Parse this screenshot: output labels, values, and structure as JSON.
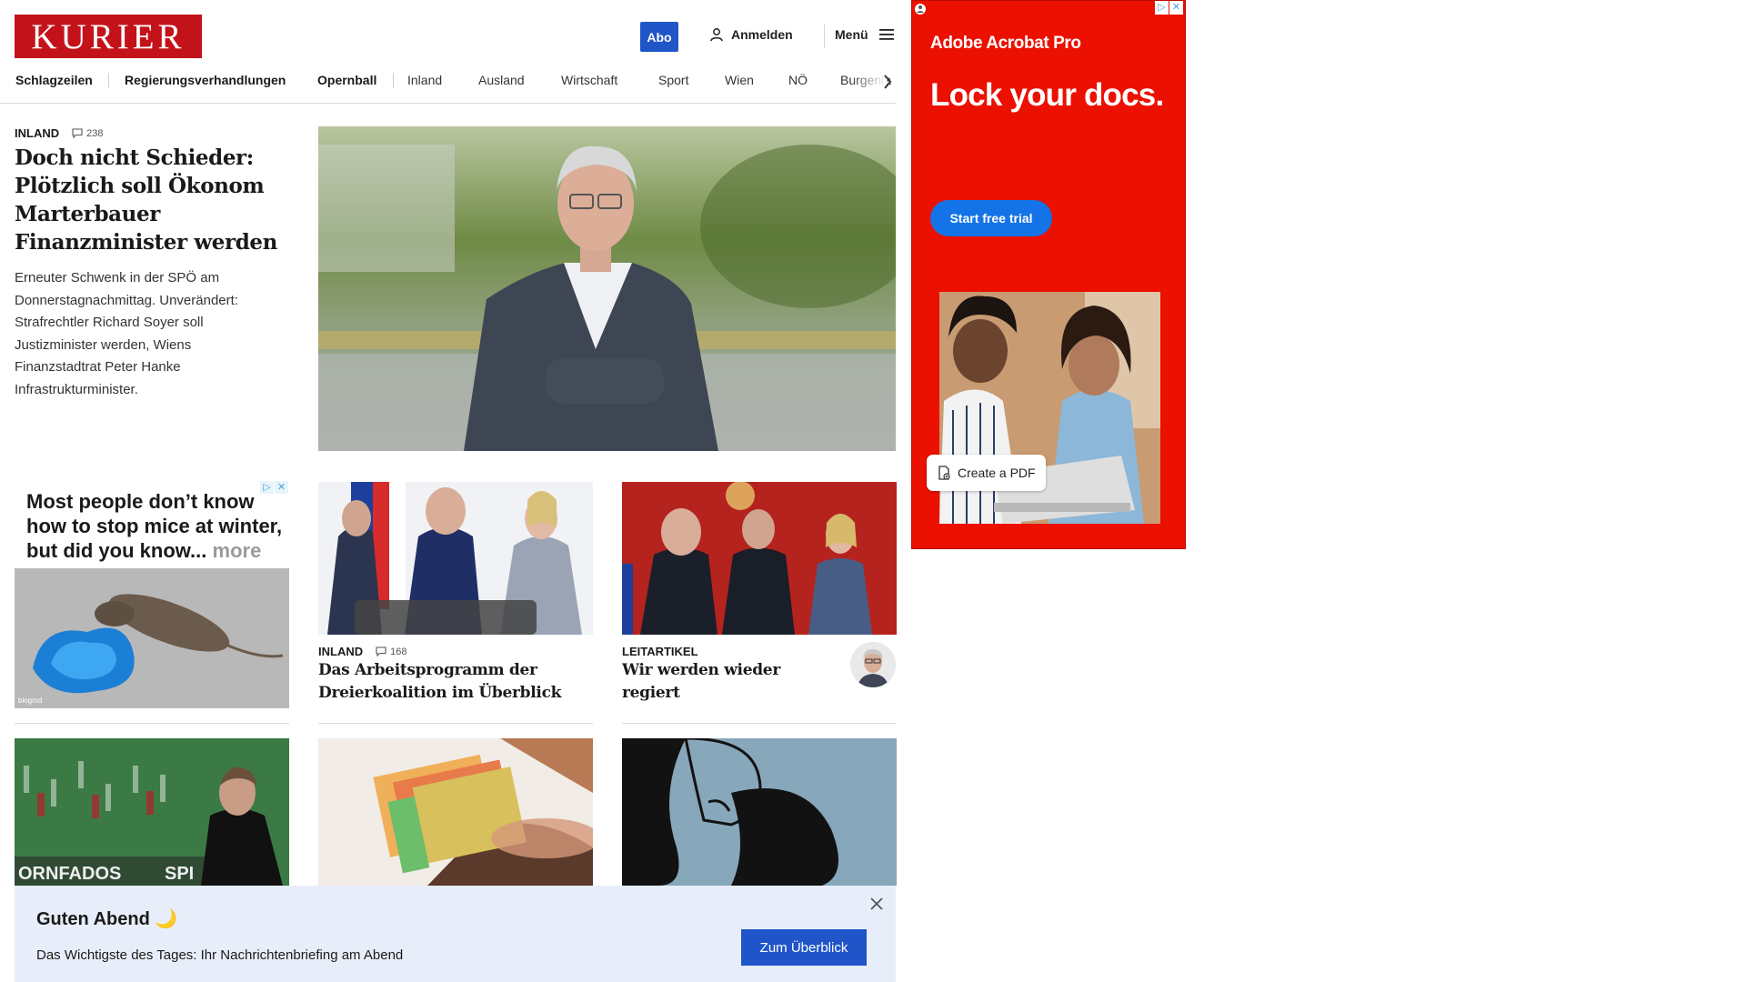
{
  "header": {
    "logo": "KURIER",
    "abo_label": "Abo",
    "login_label": "Anmelden",
    "menu_label": "Menü"
  },
  "nav": {
    "items": [
      "Schlagzeilen",
      "Regierungsverhandlungen",
      "Opernball",
      "Inland",
      "Ausland",
      "Wirtschaft",
      "Sport",
      "Wien",
      "NÖ",
      "Burgenla"
    ]
  },
  "lead": {
    "kicker": "INLAND",
    "comment_count": "238",
    "title": "Doch nicht Schieder: Plötzlich soll Ökonom Marterbauer Finanzminister werden",
    "teaser": "Erneuter Schwenk in der SPÖ am Donnerstagnachmittag. Unverändert: Strafrechtler Richard Soyer soll Justizminister werden, Wiens Finanzstadtrat Peter Hanke Infrastrukturminister."
  },
  "ad_left": {
    "text": "Most people don’t know how to stop mice at winter, but did you know...",
    "more": "more",
    "credit": "blogmd"
  },
  "cards": [
    {
      "kicker": "INLAND",
      "comment_count": "168",
      "title": "Das Arbeitsprogramm der Dreierkoalition im Überblick"
    },
    {
      "kicker": "LEITARTIKEL",
      "comment_count": "",
      "title": "Wir werden wieder regiert"
    }
  ],
  "row2": {
    "left_overlay_text": "ORNFADOS",
    "left_overlay_text2": "SPI"
  },
  "notification": {
    "title": "Guten Abend 🌙",
    "text": "Das Wichtigste des Tages: Ihr Nachrichtenbriefing am Abend",
    "button": "Zum Überblick"
  },
  "ad_right": {
    "brand": "Adobe Acrobat Pro",
    "headline": "Lock your docs.",
    "cta": "Start free trial",
    "pill": "Create a PDF"
  },
  "colors": {
    "brand_red": "#c4121a",
    "accent_blue": "#1f55c8",
    "adobe_red": "#eb1000",
    "adobe_blue": "#1473e6"
  }
}
